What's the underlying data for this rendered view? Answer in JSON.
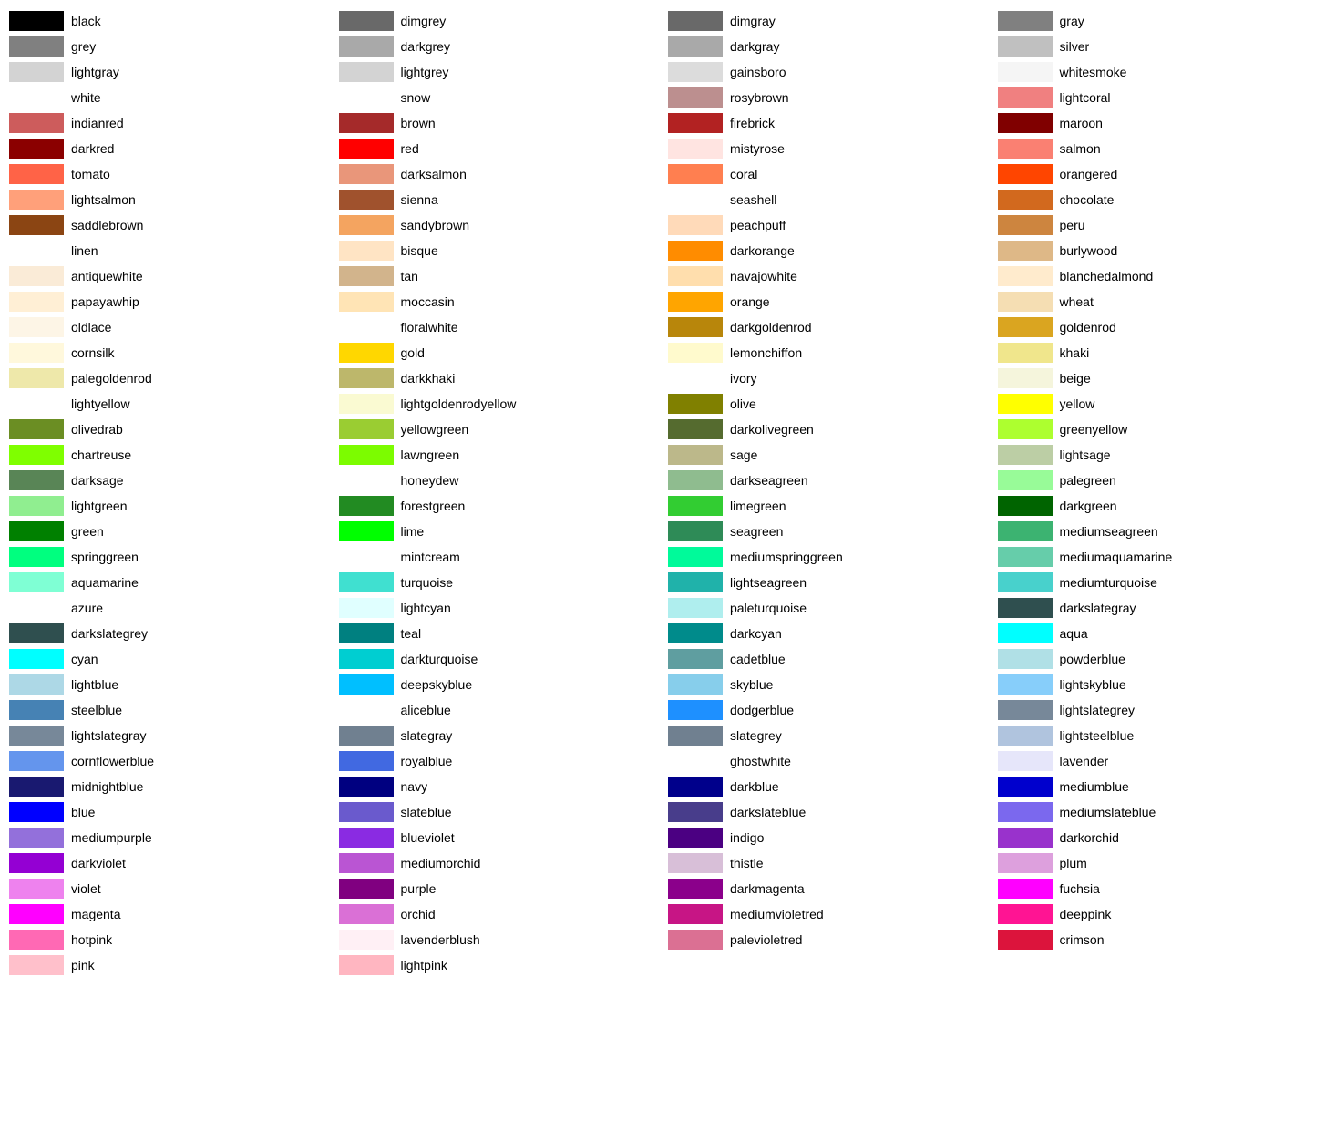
{
  "columns": [
    [
      {
        "name": "black",
        "color": "#000000"
      },
      {
        "name": "grey",
        "color": "#808080"
      },
      {
        "name": "lightgray",
        "color": "#d3d3d3"
      },
      {
        "name": "white",
        "color": null
      },
      {
        "name": "indianred",
        "color": "#cd5c5c"
      },
      {
        "name": "darkred",
        "color": "#8b0000"
      },
      {
        "name": "tomato",
        "color": "#ff6347"
      },
      {
        "name": "lightsalmon",
        "color": "#ffa07a"
      },
      {
        "name": "saddlebrown",
        "color": "#8b4513"
      },
      {
        "name": "linen",
        "color": null
      },
      {
        "name": "antiquewhite",
        "color": "#faebd7"
      },
      {
        "name": "papayawhip",
        "color": "#ffefd5"
      },
      {
        "name": "oldlace",
        "color": "#fdf5e6"
      },
      {
        "name": "cornsilk",
        "color": "#fff8dc"
      },
      {
        "name": "palegoldenrod",
        "color": "#eee8aa"
      },
      {
        "name": "lightyellow",
        "color": null
      },
      {
        "name": "olivedrab",
        "color": "#6b8e23"
      },
      {
        "name": "chartreuse",
        "color": "#7fff00"
      },
      {
        "name": "darksage",
        "color": "#598556"
      },
      {
        "name": "lightgreen",
        "color": "#90ee90"
      },
      {
        "name": "green",
        "color": "#008000"
      },
      {
        "name": "springgreen",
        "color": "#00ff7f"
      },
      {
        "name": "aquamarine",
        "color": "#7fffd4"
      },
      {
        "name": "azure",
        "color": null
      },
      {
        "name": "darkslategrey",
        "color": "#2f4f4f"
      },
      {
        "name": "cyan",
        "color": "#00ffff"
      },
      {
        "name": "lightblue",
        "color": "#add8e6"
      },
      {
        "name": "steelblue",
        "color": "#4682b4"
      },
      {
        "name": "lightslategray",
        "color": "#778899"
      },
      {
        "name": "cornflowerblue",
        "color": "#6495ed"
      },
      {
        "name": "midnightblue",
        "color": "#191970"
      },
      {
        "name": "blue",
        "color": "#0000ff"
      },
      {
        "name": "mediumpurple",
        "color": "#9370db"
      },
      {
        "name": "darkviolet",
        "color": "#9400d3"
      },
      {
        "name": "violet",
        "color": "#ee82ee"
      },
      {
        "name": "magenta",
        "color": "#ff00ff"
      },
      {
        "name": "hotpink",
        "color": "#ff69b4"
      },
      {
        "name": "pink",
        "color": "#ffc0cb"
      }
    ],
    [
      {
        "name": "dimgrey",
        "color": "#696969"
      },
      {
        "name": "darkgrey",
        "color": "#a9a9a9"
      },
      {
        "name": "lightgrey",
        "color": "#d3d3d3"
      },
      {
        "name": "snow",
        "color": null
      },
      {
        "name": "brown",
        "color": "#a52a2a"
      },
      {
        "name": "red",
        "color": "#ff0000"
      },
      {
        "name": "darksalmon",
        "color": "#e9967a"
      },
      {
        "name": "sienna",
        "color": "#a0522d"
      },
      {
        "name": "sandybrown",
        "color": "#f4a460"
      },
      {
        "name": "bisque",
        "color": "#ffe4c4"
      },
      {
        "name": "tan",
        "color": "#d2b48c"
      },
      {
        "name": "moccasin",
        "color": "#ffe4b5"
      },
      {
        "name": "floralwhite",
        "color": null
      },
      {
        "name": "gold",
        "color": "#ffd700"
      },
      {
        "name": "darkkhaki",
        "color": "#bdb76b"
      },
      {
        "name": "lightgoldenrodyellow",
        "color": "#fafad2"
      },
      {
        "name": "yellowgreen",
        "color": "#9acd32"
      },
      {
        "name": "lawngreen",
        "color": "#7cfc00"
      },
      {
        "name": "honeydew",
        "color": null
      },
      {
        "name": "forestgreen",
        "color": "#228b22"
      },
      {
        "name": "lime",
        "color": "#00ff00"
      },
      {
        "name": "mintcream",
        "color": null
      },
      {
        "name": "turquoise",
        "color": "#40e0d0"
      },
      {
        "name": "lightcyan",
        "color": "#e0ffff"
      },
      {
        "name": "teal",
        "color": "#008080"
      },
      {
        "name": "darkturquoise",
        "color": "#00ced1"
      },
      {
        "name": "deepskyblue",
        "color": "#00bfff"
      },
      {
        "name": "aliceblue",
        "color": null
      },
      {
        "name": "slategray",
        "color": "#708090"
      },
      {
        "name": "royalblue",
        "color": "#4169e1"
      },
      {
        "name": "navy",
        "color": "#000080"
      },
      {
        "name": "slateblue",
        "color": "#6a5acd"
      },
      {
        "name": "blueviolet",
        "color": "#8a2be2"
      },
      {
        "name": "mediumorchid",
        "color": "#ba55d3"
      },
      {
        "name": "purple",
        "color": "#800080"
      },
      {
        "name": "orchid",
        "color": "#da70d6"
      },
      {
        "name": "lavenderblush",
        "color": "#fff0f5"
      },
      {
        "name": "lightpink",
        "color": "#ffb6c1"
      }
    ],
    [
      {
        "name": "dimgray",
        "color": "#696969"
      },
      {
        "name": "darkgray",
        "color": "#a9a9a9"
      },
      {
        "name": "gainsboro",
        "color": "#dcdcdc"
      },
      {
        "name": "rosybrown",
        "color": "#bc8f8f"
      },
      {
        "name": "firebrick",
        "color": "#b22222"
      },
      {
        "name": "mistyrose",
        "color": "#ffe4e1"
      },
      {
        "name": "coral",
        "color": "#ff7f50"
      },
      {
        "name": "seashell",
        "color": null
      },
      {
        "name": "peachpuff",
        "color": "#ffdab9"
      },
      {
        "name": "darkorange",
        "color": "#ff8c00"
      },
      {
        "name": "navajowhite",
        "color": "#ffdead"
      },
      {
        "name": "orange",
        "color": "#ffa500"
      },
      {
        "name": "darkgoldenrod",
        "color": "#b8860b"
      },
      {
        "name": "lemonchiffon",
        "color": "#fffacd"
      },
      {
        "name": "ivory",
        "color": null
      },
      {
        "name": "olive",
        "color": "#808000"
      },
      {
        "name": "darkolivegreen",
        "color": "#556b2f"
      },
      {
        "name": "sage",
        "color": "#bcb88a"
      },
      {
        "name": "darkseagreen",
        "color": "#8fbc8f"
      },
      {
        "name": "limegreen",
        "color": "#32cd32"
      },
      {
        "name": "seagreen",
        "color": "#2e8b57"
      },
      {
        "name": "mediumspringgreen",
        "color": "#00fa9a"
      },
      {
        "name": "lightseagreen",
        "color": "#20b2aa"
      },
      {
        "name": "paleturquoise",
        "color": "#afeeee"
      },
      {
        "name": "darkcyan",
        "color": "#008b8b"
      },
      {
        "name": "cadetblue",
        "color": "#5f9ea0"
      },
      {
        "name": "skyblue",
        "color": "#87ceeb"
      },
      {
        "name": "dodgerblue",
        "color": "#1e90ff"
      },
      {
        "name": "slategrey",
        "color": "#708090"
      },
      {
        "name": "ghostwhite",
        "color": null
      },
      {
        "name": "darkblue",
        "color": "#00008b"
      },
      {
        "name": "darkslateblue",
        "color": "#483d8b"
      },
      {
        "name": "indigo",
        "color": "#4b0082"
      },
      {
        "name": "thistle",
        "color": "#d8bfd8"
      },
      {
        "name": "darkmagenta",
        "color": "#8b008b"
      },
      {
        "name": "mediumvioletred",
        "color": "#c71585"
      },
      {
        "name": "palevioletred",
        "color": "#db7093"
      }
    ],
    [
      {
        "name": "gray",
        "color": "#808080"
      },
      {
        "name": "silver",
        "color": "#c0c0c0"
      },
      {
        "name": "whitesmoke",
        "color": "#f5f5f5"
      },
      {
        "name": "lightcoral",
        "color": "#f08080"
      },
      {
        "name": "maroon",
        "color": "#800000"
      },
      {
        "name": "salmon",
        "color": "#fa8072"
      },
      {
        "name": "orangered",
        "color": "#ff4500"
      },
      {
        "name": "chocolate",
        "color": "#d2691e"
      },
      {
        "name": "peru",
        "color": "#cd853f"
      },
      {
        "name": "burlywood",
        "color": "#deb887"
      },
      {
        "name": "blanchedalmond",
        "color": "#ffebcd"
      },
      {
        "name": "wheat",
        "color": "#f5deb3"
      },
      {
        "name": "goldenrod",
        "color": "#daa520"
      },
      {
        "name": "khaki",
        "color": "#f0e68c"
      },
      {
        "name": "beige",
        "color": "#f5f5dc"
      },
      {
        "name": "yellow",
        "color": "#ffff00"
      },
      {
        "name": "greenyellow",
        "color": "#adff2f"
      },
      {
        "name": "lightsage",
        "color": "#bccea5"
      },
      {
        "name": "palegreen",
        "color": "#98fb98"
      },
      {
        "name": "darkgreen",
        "color": "#006400"
      },
      {
        "name": "mediumseagreen",
        "color": "#3cb371"
      },
      {
        "name": "mediumaquamarine",
        "color": "#66cdaa"
      },
      {
        "name": "mediumturquoise",
        "color": "#48d1cc"
      },
      {
        "name": "darkslategray",
        "color": "#2f4f4f"
      },
      {
        "name": "aqua",
        "color": "#00ffff"
      },
      {
        "name": "powderblue",
        "color": "#b0e0e6"
      },
      {
        "name": "lightskyblue",
        "color": "#87cefa"
      },
      {
        "name": "lightslategrey",
        "color": "#778899"
      },
      {
        "name": "lightsteelblue",
        "color": "#b0c4de"
      },
      {
        "name": "lavender",
        "color": "#e6e6fa"
      },
      {
        "name": "mediumblue",
        "color": "#0000cd"
      },
      {
        "name": "mediumslateblue",
        "color": "#7b68ee"
      },
      {
        "name": "darkorchid",
        "color": "#9932cc"
      },
      {
        "name": "plum",
        "color": "#dda0dd"
      },
      {
        "name": "fuchsia",
        "color": "#ff00ff"
      },
      {
        "name": "deeppink",
        "color": "#ff1493"
      },
      {
        "name": "crimson",
        "color": "#dc143c"
      }
    ]
  ]
}
